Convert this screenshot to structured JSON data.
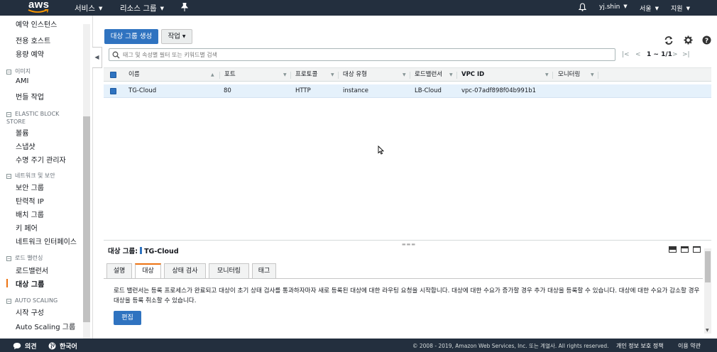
{
  "topnav": {
    "logo_text": "aws",
    "services_label": "서비스",
    "resource_groups_label": "리소스 그룹",
    "user_label": "yj.shin",
    "region_label": "서울",
    "support_label": "지원"
  },
  "sidebar": {
    "items": [
      {
        "label": "예약 인스턴스"
      },
      {
        "label": "전용 호스트"
      },
      {
        "label": "용량 예약"
      },
      {
        "label": "AMI"
      },
      {
        "label": "번들 작업"
      },
      {
        "label": "볼륨"
      },
      {
        "label": "스냅샷"
      },
      {
        "label": "수명 주기 관리자"
      },
      {
        "label": "보안 그룹"
      },
      {
        "label": "탄력적 IP"
      },
      {
        "label": "배치 그룹"
      },
      {
        "label": "키 페어"
      },
      {
        "label": "네트워크 인터페이스"
      },
      {
        "label": "로드밸런서"
      },
      {
        "label": "대상 그룹"
      },
      {
        "label": "시작 구성"
      },
      {
        "label": "Auto Scaling 그룹"
      }
    ],
    "sections": [
      {
        "label": "이미지"
      },
      {
        "label": "ELASTIC BLOCK STORE"
      },
      {
        "label": "네트워크 및 보안"
      },
      {
        "label": "로드 밸런싱"
      },
      {
        "label": "AUTO SCALING"
      }
    ]
  },
  "toolbar": {
    "create_label": "대상 그룹 생성",
    "actions_label": "작업"
  },
  "search": {
    "placeholder": "태그 및 속성별 필터 또는 키워드별 검색",
    "value": ""
  },
  "pagination": {
    "count": "1 ~ 1/1"
  },
  "table": {
    "columns": [
      "이름",
      "포트",
      "프로토콜",
      "대상 유형",
      "로드밸런서",
      "VPC ID",
      "모니터링"
    ],
    "rows": [
      {
        "name": "TG-Cloud",
        "port": "80",
        "protocol": "HTTP",
        "target_type": "instance",
        "load_balancer": "LB-Cloud",
        "vpc_id": "vpc-07adf898f04b991b1",
        "monitoring": ""
      }
    ]
  },
  "detail": {
    "title_label": "대상 그룹:",
    "title_value": "TG-Cloud",
    "tabs": [
      "설명",
      "대상",
      "상태 검사",
      "모니터링",
      "태그"
    ],
    "description": "로드 밸런서는 등록 프로세스가 완료되고 대상이 초기 상태 검사를 통과하자마자 새로 등록된 대상에 대한 라우팅 요청을 시작합니다. 대상에 대한 수요가 증가할 경우 추가 대상을 등록할 수 있습니다. 대상에 대한 수요가 감소할 경우 대상을 등록 취소할 수 있습니다.",
    "edit_label": "편집"
  },
  "footer": {
    "feedback_label": "의견",
    "language_label": "한국어",
    "copyright": "© 2008 - 2019, Amazon Web Services, Inc. 또는 계열사. All rights reserved.",
    "privacy_label": "개인 정보 보호 정책",
    "terms_label": "이용 약관"
  },
  "colors": {
    "nav_bg": "#232f3e",
    "primary": "#2f73c0",
    "accent": "#ec7211",
    "selected_row": "#e5f1fb"
  }
}
